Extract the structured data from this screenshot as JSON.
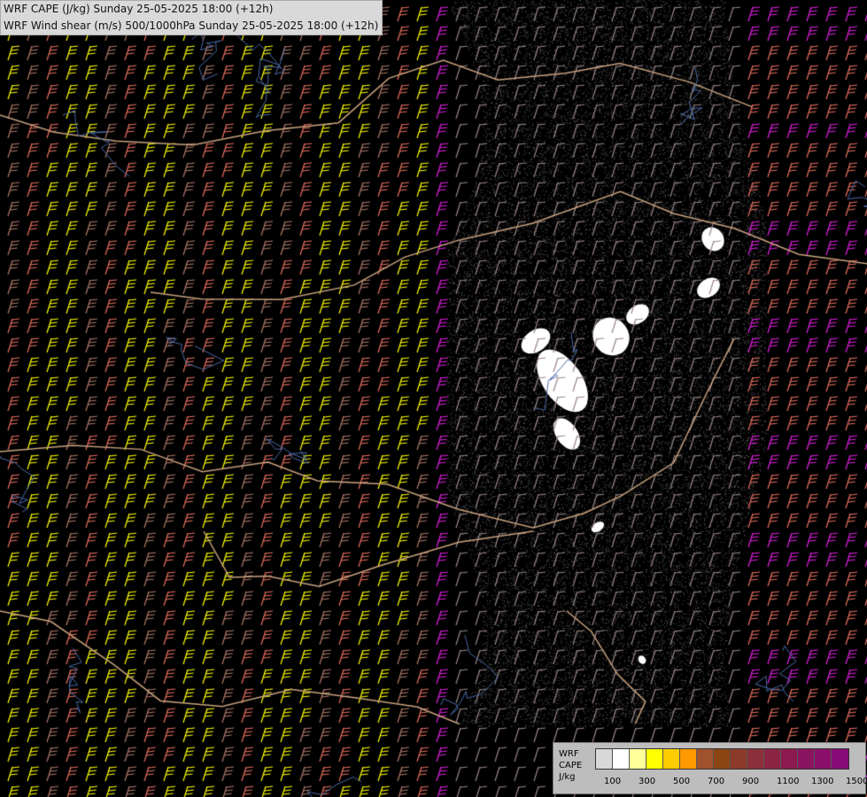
{
  "header": {
    "line1": "WRF CAPE (J/kg) Sunday 25-05-2025 18:00 (+12h)",
    "line2": "WRF Wind shear (m/s) 500/1000hPa Sunday 25-05-2025 18:00 (+12h)"
  },
  "legend": {
    "title_lines": [
      "WRF",
      "CAPE",
      "J/kg"
    ],
    "colors": [
      "#d8d8d8",
      "#ffffff",
      "#ffff99",
      "#ffff00",
      "#ffcc00",
      "#ff9900",
      "#a0522d",
      "#8b4513",
      "#8b3a2a",
      "#8b2f3a",
      "#8b2445",
      "#8b1a4f",
      "#8b1460",
      "#8b0f6a",
      "#880a78"
    ],
    "tick_labels": [
      "100",
      "300",
      "500",
      "700",
      "900",
      "1100",
      "1300",
      "1500"
    ]
  },
  "map": {
    "background": "#000000",
    "barb_colors": {
      "weak": "#9a8686",
      "moderate": "#b07a6a",
      "strong": "#e87060",
      "stronger": "#ffff00",
      "strongest": "#e020e0"
    },
    "border_color": "#c8a27e",
    "river_color": "#4a6aa8"
  }
}
